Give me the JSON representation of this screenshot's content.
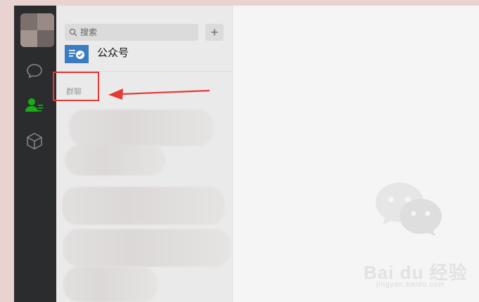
{
  "search": {
    "placeholder": "搜索"
  },
  "toolbar": {
    "add_label": "+"
  },
  "contacts": {
    "official_account_label": "公众号",
    "section_label": "群聊"
  },
  "watermark": {
    "text": "Bai du 经验",
    "url": "jingyan.baidu.com"
  },
  "colors": {
    "accent": "#1aad19",
    "annotation": "#e53935"
  },
  "icons": {
    "rail": [
      "chat-icon",
      "contacts-icon",
      "box-icon"
    ]
  }
}
